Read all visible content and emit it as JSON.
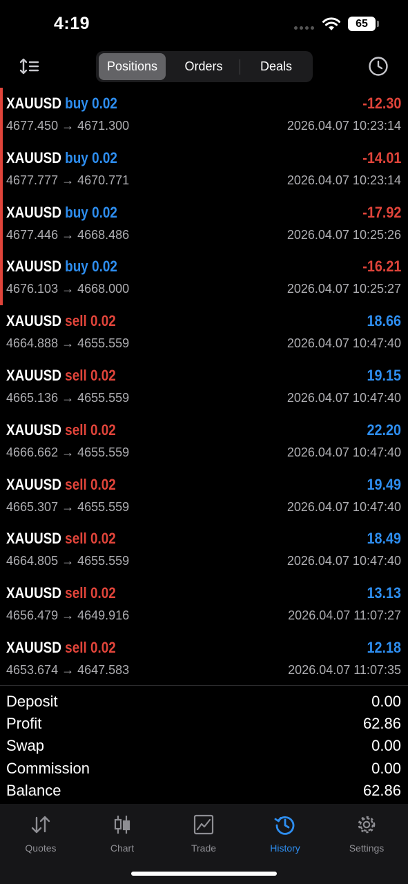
{
  "status_bar": {
    "time": "4:19",
    "battery": "65"
  },
  "header": {
    "sort_icon": "sort-list-icon",
    "clock_icon": "clock-icon",
    "tabs": [
      {
        "label": "Positions",
        "active": true
      },
      {
        "label": "Orders",
        "active": false
      },
      {
        "label": "Deals",
        "active": false
      }
    ]
  },
  "trades": [
    {
      "symbol": "XAUUSD",
      "side": "buy",
      "volume": "0.02",
      "open_price": "4677.450",
      "close_price": "4671.300",
      "arrow": "→",
      "profit": "-12.30",
      "time": "2026.04.07 10:23:14"
    },
    {
      "symbol": "XAUUSD",
      "side": "buy",
      "volume": "0.02",
      "open_price": "4677.777",
      "close_price": "4670.771",
      "arrow": "→",
      "profit": "-14.01",
      "time": "2026.04.07 10:23:14"
    },
    {
      "symbol": "XAUUSD",
      "side": "buy",
      "volume": "0.02",
      "open_price": "4677.446",
      "close_price": "4668.486",
      "arrow": "→",
      "profit": "-17.92",
      "time": "2026.04.07 10:25:26"
    },
    {
      "symbol": "XAUUSD",
      "side": "buy",
      "volume": "0.02",
      "open_price": "4676.103",
      "close_price": "4668.000",
      "arrow": "→",
      "profit": "-16.21",
      "time": "2026.04.07 10:25:27"
    },
    {
      "symbol": "XAUUSD",
      "side": "sell",
      "volume": "0.02",
      "open_price": "4664.888",
      "close_price": "4655.559",
      "arrow": "→",
      "profit": "18.66",
      "time": "2026.04.07 10:47:40"
    },
    {
      "symbol": "XAUUSD",
      "side": "sell",
      "volume": "0.02",
      "open_price": "4665.136",
      "close_price": "4655.559",
      "arrow": "→",
      "profit": "19.15",
      "time": "2026.04.07 10:47:40"
    },
    {
      "symbol": "XAUUSD",
      "side": "sell",
      "volume": "0.02",
      "open_price": "4666.662",
      "close_price": "4655.559",
      "arrow": "→",
      "profit": "22.20",
      "time": "2026.04.07 10:47:40"
    },
    {
      "symbol": "XAUUSD",
      "side": "sell",
      "volume": "0.02",
      "open_price": "4665.307",
      "close_price": "4655.559",
      "arrow": "→",
      "profit": "19.49",
      "time": "2026.04.07 10:47:40"
    },
    {
      "symbol": "XAUUSD",
      "side": "sell",
      "volume": "0.02",
      "open_price": "4664.805",
      "close_price": "4655.559",
      "arrow": "→",
      "profit": "18.49",
      "time": "2026.04.07 10:47:40"
    },
    {
      "symbol": "XAUUSD",
      "side": "sell",
      "volume": "0.02",
      "open_price": "4656.479",
      "close_price": "4649.916",
      "arrow": "→",
      "profit": "13.13",
      "time": "2026.04.07 11:07:27"
    },
    {
      "symbol": "XAUUSD",
      "side": "sell",
      "volume": "0.02",
      "open_price": "4653.674",
      "close_price": "4647.583",
      "arrow": "→",
      "profit": "12.18",
      "time": "2026.04.07 11:07:35"
    }
  ],
  "summary": [
    {
      "label": "Deposit",
      "value": "0.00"
    },
    {
      "label": "Profit",
      "value": "62.86"
    },
    {
      "label": "Swap",
      "value": "0.00"
    },
    {
      "label": "Commission",
      "value": "0.00"
    },
    {
      "label": "Balance",
      "value": "62.86"
    }
  ],
  "tab_bar": [
    {
      "label": "Quotes",
      "icon": "quotes-arrows-icon",
      "active": false
    },
    {
      "label": "Chart",
      "icon": "candlestick-icon",
      "active": false
    },
    {
      "label": "Trade",
      "icon": "trade-chart-icon",
      "active": false
    },
    {
      "label": "History",
      "icon": "history-icon",
      "active": true
    },
    {
      "label": "Settings",
      "icon": "gear-icon",
      "active": false
    }
  ],
  "colors": {
    "background": "#000000",
    "buy": "#2e8ef0",
    "sell": "#e0443a",
    "secondary_text": "#aeaeb2",
    "active_tab": "#2e8ef0",
    "inactive_tab": "#8e8e93"
  }
}
